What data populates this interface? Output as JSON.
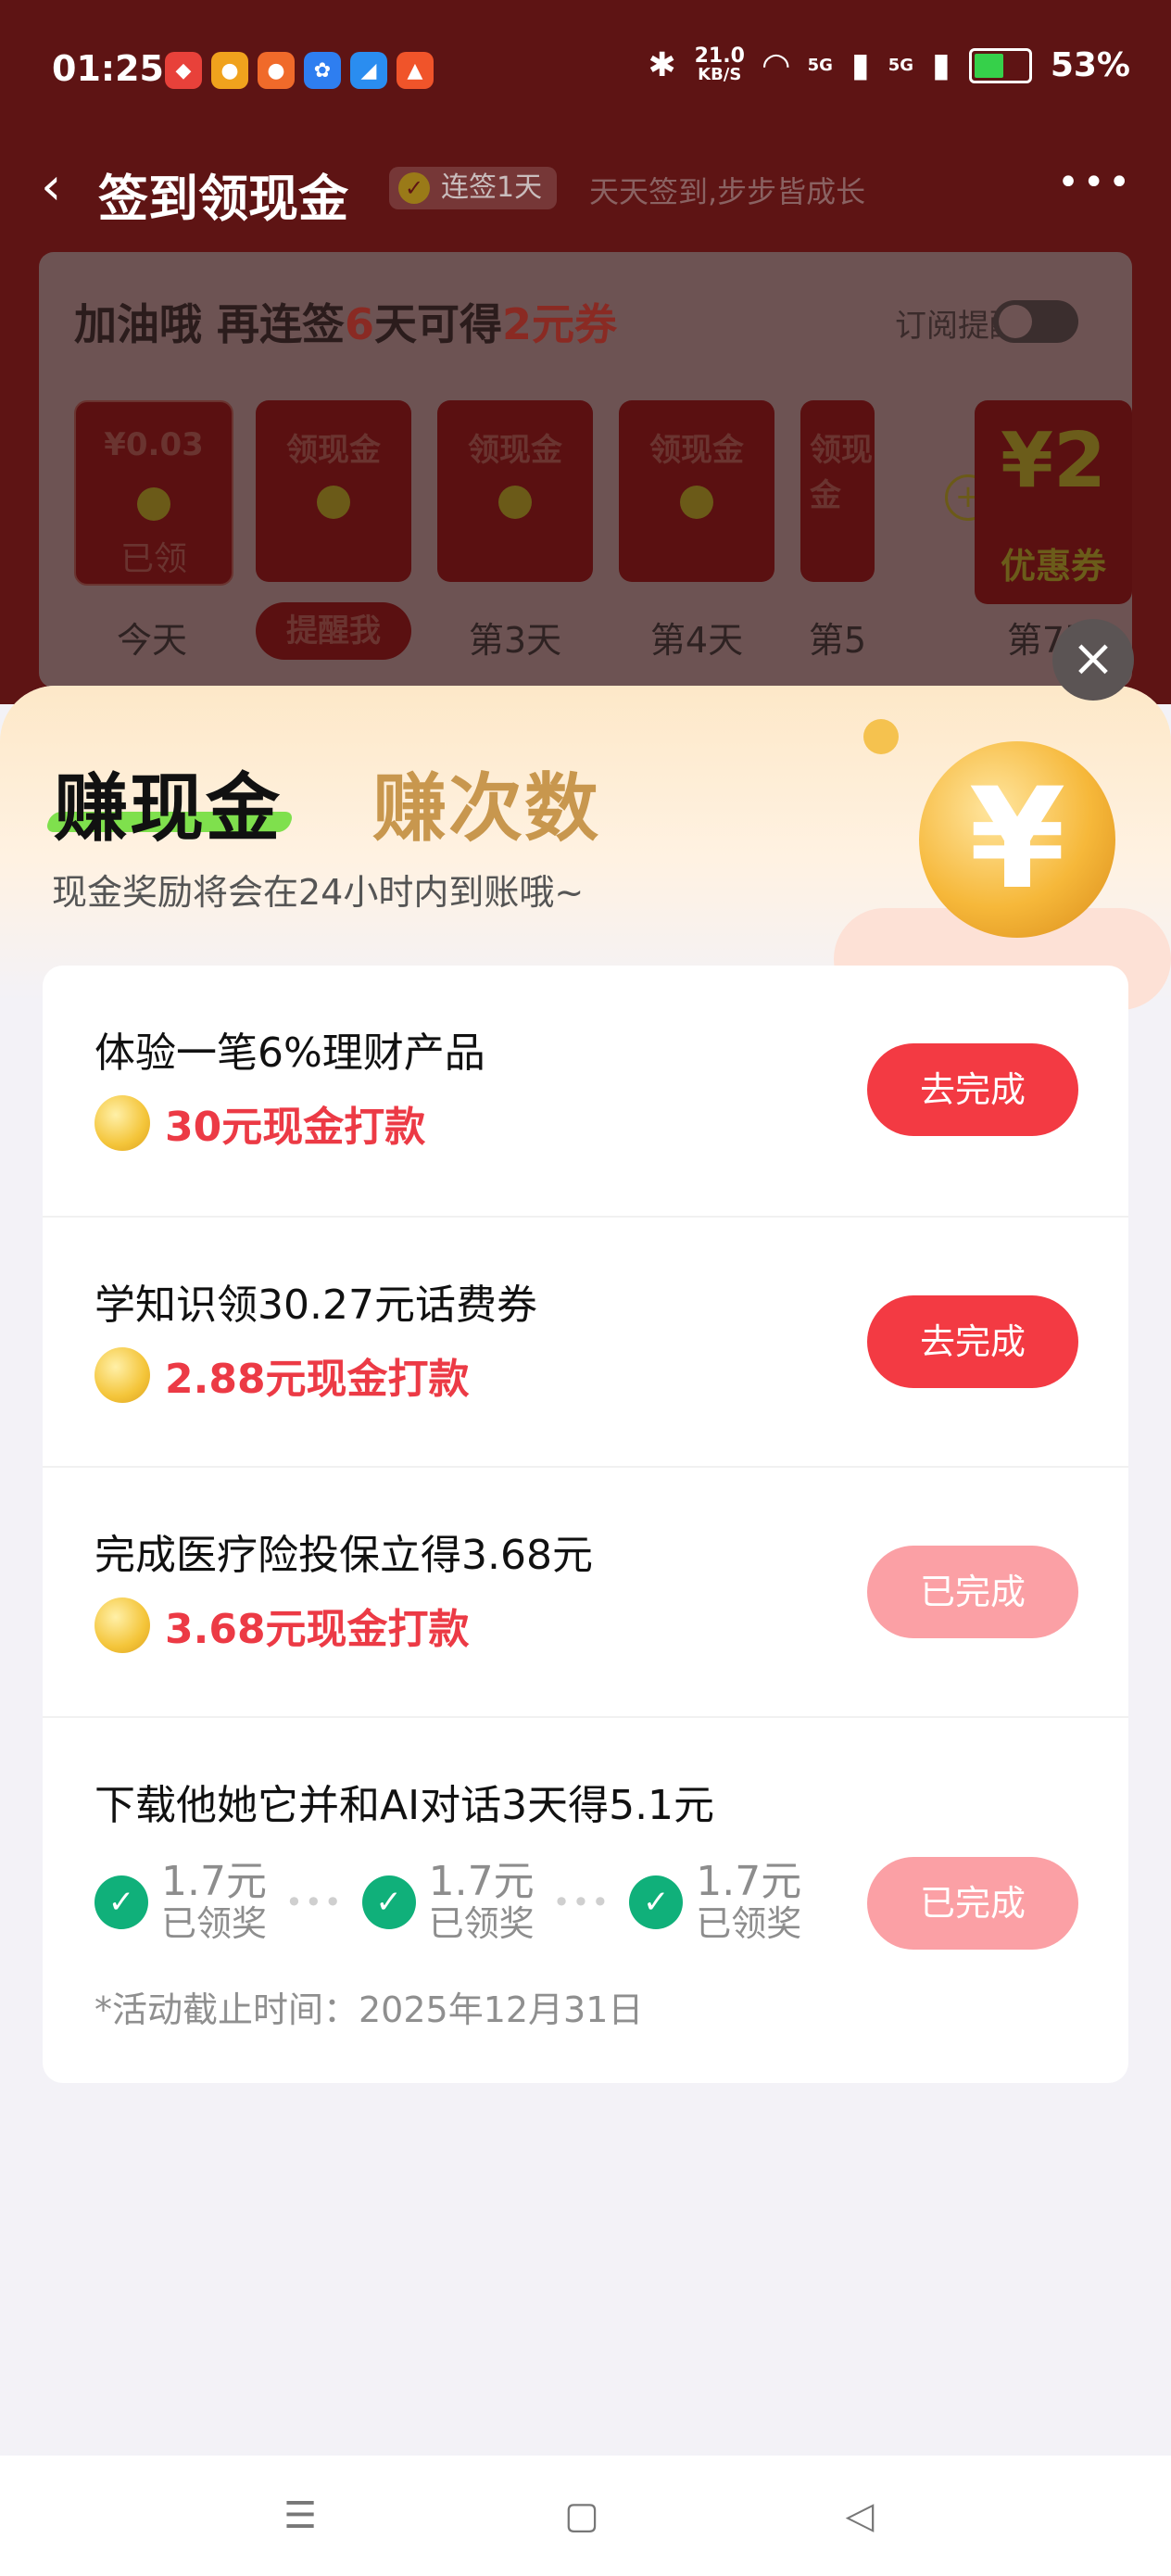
{
  "status_bar": {
    "time": "01:25",
    "speed_value": "21.0",
    "speed_unit": "KB/S",
    "net1": "5G",
    "net2": "5G",
    "battery": "53%"
  },
  "header": {
    "title": "签到领现金",
    "streak": "连签1天",
    "slogan": "天天签到,步步皆成长"
  },
  "sign_card": {
    "message_a": "加油哦 再连签",
    "message_days": "6",
    "message_b": "天可得",
    "message_amount": "2元券",
    "subscribe_label": "订阅提醒",
    "day1_amount": "¥0.03",
    "day1_status": "已领",
    "days_label": [
      "领现金",
      "领现金",
      "领现金",
      "领现金"
    ],
    "day_names": [
      "今天",
      "提醒我",
      "第3天",
      "第4天",
      "第5",
      "第7天"
    ],
    "coupon_amount": "¥2",
    "coupon_text": "优惠券"
  },
  "sheet": {
    "tab_cash": "赚现金",
    "tab_count": "赚次数",
    "subtitle": "现金奖励将会在24小时内到账哦~",
    "tasks": [
      {
        "title": "体验一笔6%理财产品",
        "reward": "30元现金打款",
        "button": "去完成",
        "state": "active"
      },
      {
        "title": "学知识领30.27元话费券",
        "reward": "2.88元现金打款",
        "button": "去完成",
        "state": "active"
      },
      {
        "title": "完成医疗险投保立得3.68元",
        "reward": "3.68元现金打款",
        "button": "已完成",
        "state": "done"
      },
      {
        "title": "下载他她它并和AI对话3天得5.1元",
        "button": "已完成",
        "state": "done",
        "steps": [
          {
            "value": "1.7元",
            "label": "已领奖"
          },
          {
            "value": "1.7元",
            "label": "已领奖"
          },
          {
            "value": "1.7元",
            "label": "已领奖"
          }
        ],
        "deadline": "*活动截止时间：2025年12月31日"
      }
    ]
  },
  "colors": {
    "primary_red": "#f33a43",
    "done_red": "#fba0a5",
    "reward_red": "#ec3a45",
    "check_green": "#10b07a"
  }
}
